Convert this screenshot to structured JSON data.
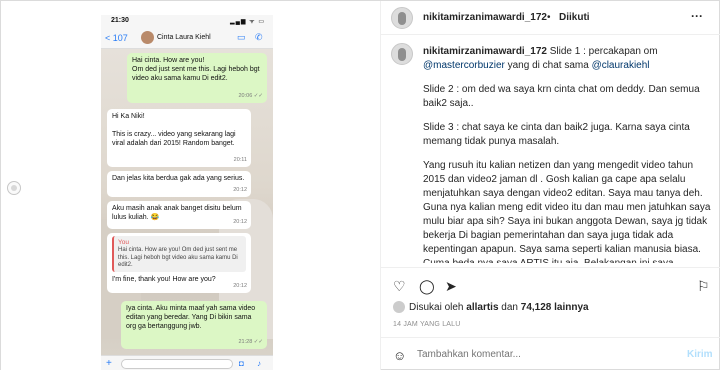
{
  "post": {
    "username": "nikitamirzanimawardi_172",
    "separator": "•",
    "follow_status": "Diikuti",
    "more": "···"
  },
  "caption": {
    "username": "nikitamirzanimawardi_172",
    "line1": "Slide 1 : percakapan om",
    "mention1": "@mastercorbuzier",
    "line1b": " yang di chat sama ",
    "mention2": "@claurakiehl",
    "p2": "Slide 2 : om ded wa saya krn cinta chat om deddy. Dan semua baik2 saja..",
    "p3": "Slide 3 : chat saya ke cinta dan baik2 juga. Karna saya cinta memang tidak punya masalah.",
    "p4": "Yang rusuh itu kalian netizen dan yang mengedit video tahun 2015 dan video2 jaman dl . Gosh kalian ga cape apa selalu menjatuhkan saya dengan video2 editan. Saya mau tanya deh. Guna nya kalian meng edit video itu dan mau men jatuhkan saya mulu biar apa sih? Saya ini bukan anggota Dewan, saya jg tidak bekerja Di bagian pemerintahan dan saya juga tidak ada kepentingan apapun. Saya sama seperti kalian manusia biasa. Cuma beda nya saya ARTIS itu aja. Belakangan ini saya perhatikan lagi banyak bgt waktu untuk meng"
  },
  "likes": {
    "prefix": "Disukai oleh ",
    "user": "allartis",
    "middle": " dan ",
    "count": "74,128 lainnya"
  },
  "date": "14 JAM YANG LALU",
  "comment": {
    "placeholder": "Tambahkan komentar...",
    "post_label": "Kirim"
  },
  "icons": {
    "like": "heart-icon",
    "comment": "comment-icon",
    "share": "share-icon",
    "save": "bookmark-icon",
    "emoji": "emoji-icon"
  },
  "phone": {
    "time": "21:30",
    "signal": "▂▄▆ ᯤ ▭",
    "back": "< 107",
    "contact": "Cinta Laura Kiehl",
    "messages": [
      {
        "dir": "out",
        "text": "Hai cinta. How are you!\nOm ded just sent me this. Lagi heboh bgt video aku sama kamu Di edit2.",
        "time": "20:06 ✓✓"
      },
      {
        "dir": "in",
        "text": "Hi Ka Niki!\n\nThis is crazy... video yang sekarang lagi viral adalah dari 2015! Random banget.",
        "time": "20:11"
      },
      {
        "dir": "in",
        "text": "Dan jelas kita berdua gak ada yang serius.",
        "time": "20:12"
      },
      {
        "dir": "in",
        "text": "Aku masih anak anak banget disitu belum lulus kuliah. 😂",
        "time": "20:12"
      },
      {
        "dir": "in",
        "reply_label": "You",
        "reply_text": "Hai cinta. How are you!\nOm ded just sent me this. Lagi heboh bgt video aku sama kamu Di edit2.",
        "text": "I'm fine, thank you! How are you?",
        "time": "20:12"
      },
      {
        "dir": "out",
        "text": "Iya cinta. Aku minta maaf yah sama video editan yang beredar. Yang Di bikin sama org ga bertanggung jwb.",
        "time": "21:28 ✓✓"
      }
    ]
  }
}
